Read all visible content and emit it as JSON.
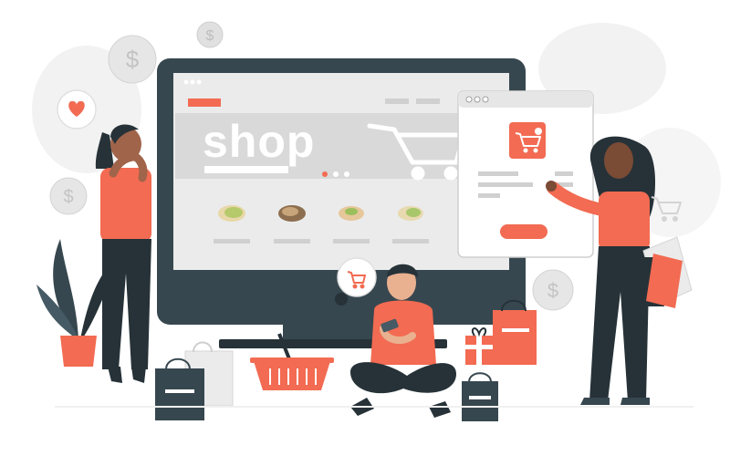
{
  "hero": {
    "word": "shop"
  },
  "colors": {
    "accent": "#F26B52",
    "dark": "#263238",
    "monitor": "#37474F",
    "screen": "#EBEBEB",
    "banner": "#D9D9D9",
    "blob": "#F2F2F2"
  },
  "icons": [
    "heart-icon",
    "cart-icon",
    "dollar-icon",
    "pistachio-icon",
    "walnut-icon",
    "peanut-icon",
    "cashew-icon"
  ],
  "products_count": 4,
  "carousel": {
    "dots": 3,
    "active_dot": 1
  }
}
